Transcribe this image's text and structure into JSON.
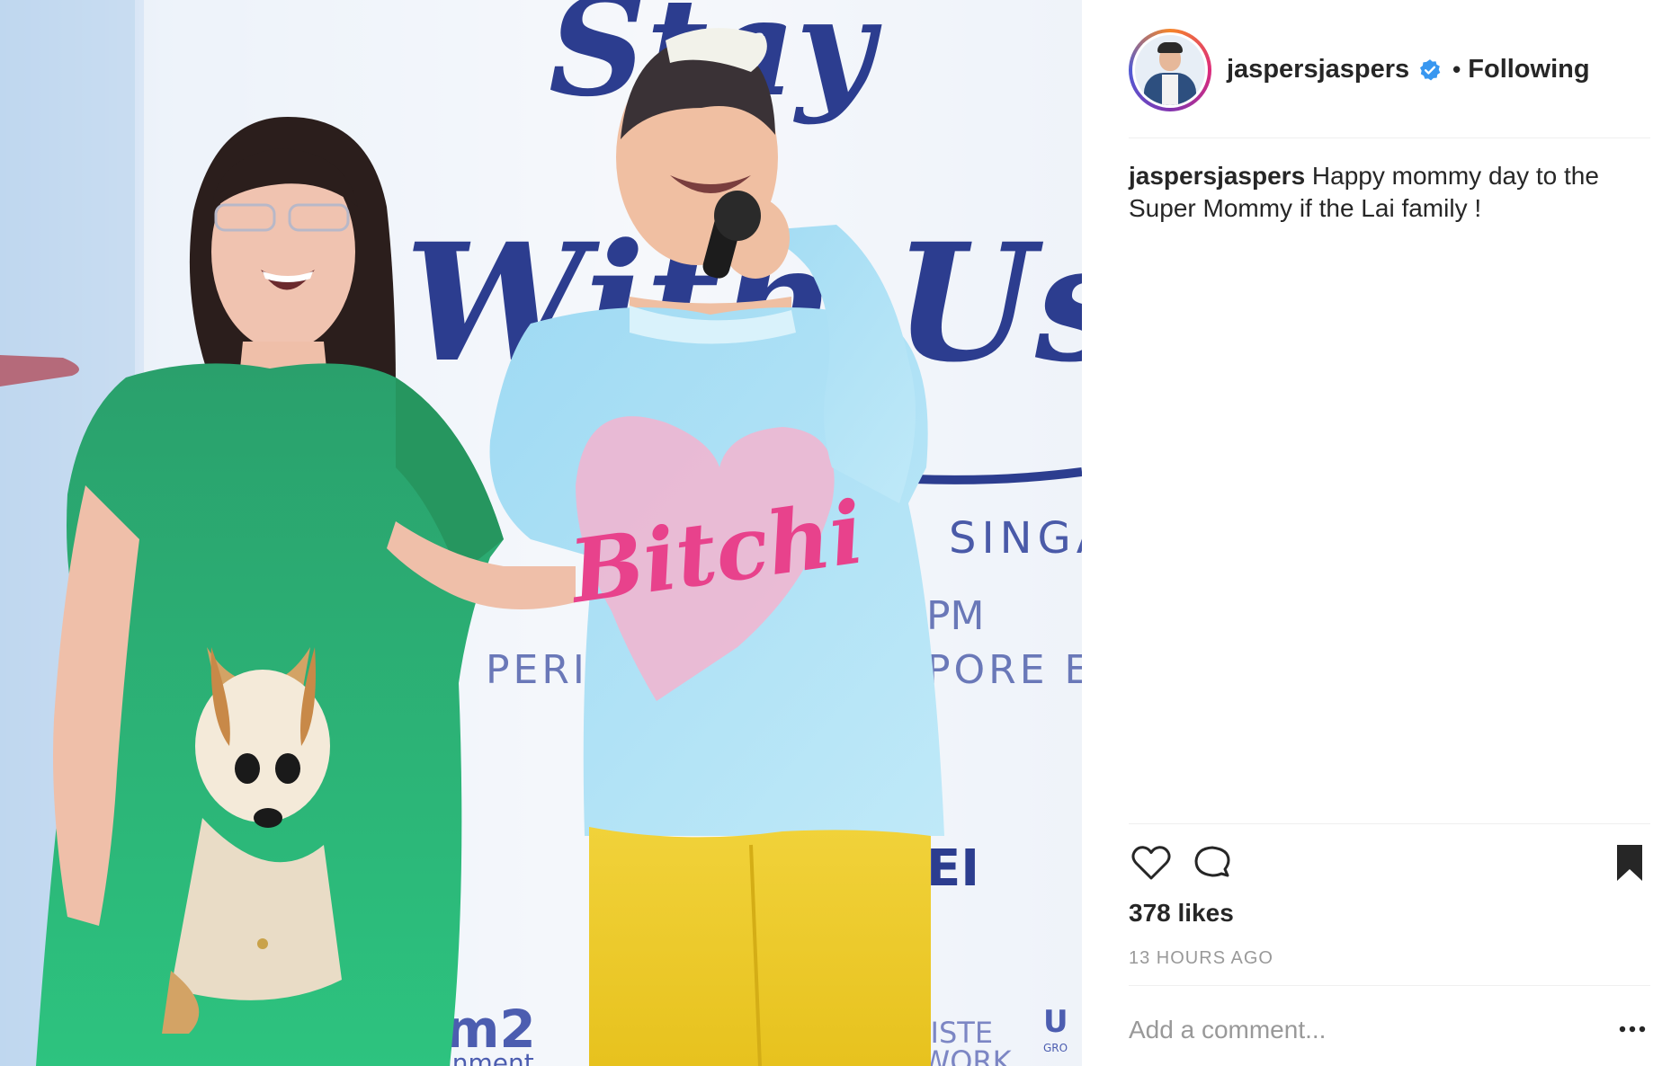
{
  "post": {
    "username": "jaspersjaspers",
    "verified": true,
    "follow_status": "Following",
    "separator": "•",
    "caption_username": "jaspersjaspers",
    "caption_text": "Happy mommy day to the Super Mommy if the Lai family !",
    "likes": "378 likes",
    "timestamp": "13 HOURS AGO",
    "comment_placeholder": "Add a comment..."
  },
  "photo": {
    "banner_text_1": "SINGAP",
    "banner_text_2": "PERIDO",
    "banner_text_3": "PM",
    "banner_text_4": "PORE EXP",
    "banner_text_5": "EI",
    "sponsor_1": "m2",
    "sponsor_1b": "inment",
    "sponsor_2": "TISTE",
    "sponsor_2b": "TWORK",
    "sponsor_3": "U",
    "sponsor_3b": "GRO",
    "shirt_text": "Bitchi",
    "script_text_1": "Stay",
    "script_text_2": "With Us"
  },
  "icons": {
    "like": "heart-icon",
    "comment": "comment-bubble-icon",
    "save": "bookmark-icon",
    "more": "more-options-icon",
    "verified": "verified-badge-icon"
  },
  "colors": {
    "verified_blue": "#3897f0",
    "text": "#262626",
    "muted": "#999999",
    "divider": "#efefef"
  }
}
